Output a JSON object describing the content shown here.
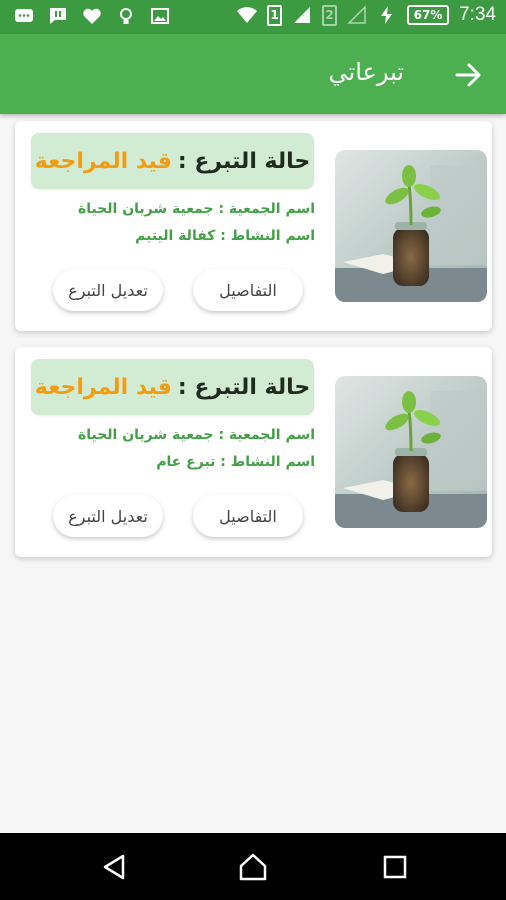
{
  "status_bar": {
    "icons": [
      "chat-icon",
      "message-icon",
      "heart-icon",
      "bulb-icon",
      "image-icon"
    ],
    "sim1": "1",
    "sim2": "2",
    "battery": "67%",
    "time": "7:34"
  },
  "app_bar": {
    "title": "تبرعاتي",
    "back_icon": "arrow-right-icon"
  },
  "donations": [
    {
      "status_label": "حالة التبرع :",
      "status_value": "قيد المراجعة",
      "association": "اسم الجمعية : جمعية شريان الحياة",
      "activity": "اسم النشاط : كفالة اليتيم",
      "details_label": "التفاصيل",
      "edit_label": "تعديل التبرع"
    },
    {
      "status_label": "حالة التبرع :",
      "status_value": "قيد المراجعة",
      "association": "اسم الجمعية : جمعية شريان الحياة",
      "activity": "اسم النشاط : تبرع عام",
      "details_label": "التفاصيل",
      "edit_label": "تعديل التبرع"
    }
  ],
  "colors": {
    "status_bar": "#3c9a41",
    "app_bar": "#4caf50",
    "status_pill": "#d2ecd3",
    "status_value": "#f39c12",
    "info_text": "#43a047"
  },
  "nav_bar": {
    "icons": [
      "back-triangle-icon",
      "home-icon",
      "recent-apps-icon"
    ]
  }
}
